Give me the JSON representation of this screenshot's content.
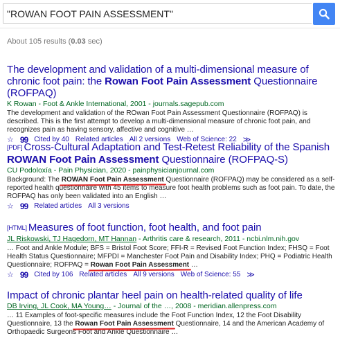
{
  "search": {
    "query": "\"ROWAN FOOT PAIN ASSESSMENT\""
  },
  "stats": {
    "prefix": "About 105 results (",
    "time": "0.03",
    "suffix": " sec)"
  },
  "results": [
    {
      "tag": "",
      "title_pre": "The development and validation of a multi-dimensional measure of chronic foot pain: the ",
      "title_bold": "Rowan Foot Pain Assessment",
      "title_post": " Questionnaire (ROFPAQ)",
      "authors": "K Rowan",
      "source": " - Foot & Ankle International, 2001 - journals.sagepub.com",
      "snippet_pre": "The development and validation of the ROwan Foot Pain Assessment Questionnaire (ROFPAQ) is described. This is the first attempt to develop a multi-dimensional measure of chronic foot pain, and recognizes pain as having sensory, affective and cognitive …",
      "snippet_bold": "",
      "snippet_post": "",
      "cited": "Cited by 40",
      "related": "Related articles",
      "versions": "All 2 versions",
      "wos": "Web of Science: 22"
    },
    {
      "tag": "[PDF]",
      "title_pre": "Cross-Cultural Adaptation and Test-Retest Reliability of the Spanish ",
      "title_bold": "ROWAN Foot Pain Assessment",
      "title_post": " Questionnaire (ROFPAQ-S)",
      "authors": "CU Podoloxía",
      "source": " - Pain Physician, 2020 - painphysicianjournal.com",
      "snippet_pre": "Background: The ",
      "snippet_bold": "ROWAN Foot Pain Assessment",
      "snippet_post": " Questionnaire (ROFPAQ) may be considered as a self-reported health questionnaire with 45 items to measure foot health problems such as foot pain. To date, the ROFPAQ has only been validated into an English …",
      "cited": "",
      "related": "Related articles",
      "versions": "All 3 versions",
      "wos": ""
    },
    {
      "tag": "[HTML]",
      "title_pre": "Measures of foot function, foot health, and foot pain",
      "title_bold": "",
      "title_post": "",
      "authors": "JL Riskowski, TJ Hagedorn, MT Hannan",
      "source": " - Arthritis care & research, 2011 - ncbi.nlm.nih.gov",
      "snippet_pre": "… Foot and Ankle Module; BFS = Bristol Foot Score; FFI-R = Revised Foot Function Index; FHSQ = Foot Health Status Questionnaire; MFPDI = Manchester Foot Pain and Disability Index; PHQ = Podiatric Health Questionnaire; ROFPAQ = ",
      "snippet_bold": "Rowan Foot Pain Assessment",
      "snippet_post": " …",
      "cited": "Cited by 106",
      "related": "Related articles",
      "versions": "All 9 versions",
      "wos": "Web of Science: 55"
    },
    {
      "tag": "",
      "title_pre": "Impact of chronic plantar heel pain on health-related quality of life",
      "title_bold": "",
      "title_post": "",
      "authors": "DB Irving, JL Cook, MA Young…",
      "source": " - Journal of the …, 2008 - meridian.allenpress.com",
      "snippet_pre": "… 11 Examples of foot-specific measures include the Foot Function Index, 12 the Foot Disability Questionnaire, 13 the ",
      "snippet_bold": "Rowan Foot Pain Assessment",
      "snippet_post": " Questionnaire, 14 and the American Academy of Orthopaedic Surgeons Foot and Ankle Questionnaire …",
      "cited": "",
      "related": "",
      "versions": "",
      "wos": ""
    }
  ]
}
